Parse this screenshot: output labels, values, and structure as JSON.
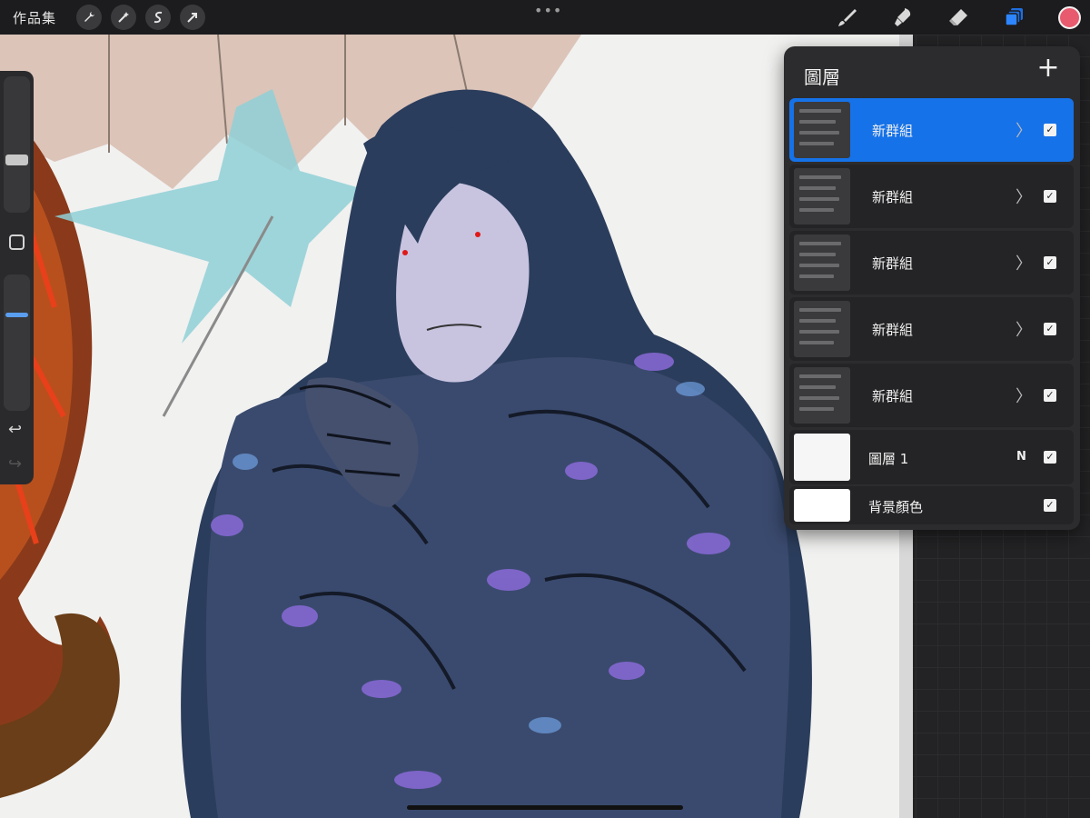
{
  "topbar": {
    "gallery_label": "作品集",
    "tools_left": [
      {
        "icon": "wrench-icon",
        "label": "actions"
      },
      {
        "icon": "magic-wand-icon",
        "label": "adjustments"
      },
      {
        "icon": "selection-icon",
        "label": "selection"
      },
      {
        "icon": "transform-arrow-icon",
        "label": "transform"
      }
    ],
    "more": "•••",
    "tools_right": [
      {
        "icon": "brush-icon"
      },
      {
        "icon": "smudge-icon"
      },
      {
        "icon": "eraser-icon"
      },
      {
        "icon": "layers-icon",
        "active": true
      }
    ],
    "current_color": "#e85a6e"
  },
  "sidebar": {
    "brush_size_level": 0.62,
    "opacity_level": 0.38,
    "undo": "↩",
    "redo": "↪"
  },
  "layers": {
    "title": "圖層",
    "add": "+",
    "items": [
      {
        "name": "新群組",
        "type": "group",
        "selected": true,
        "visible": true
      },
      {
        "name": "新群組",
        "type": "group",
        "selected": false,
        "visible": true
      },
      {
        "name": "新群組",
        "type": "group",
        "selected": false,
        "visible": true
      },
      {
        "name": "新群組",
        "type": "group",
        "selected": false,
        "visible": true
      },
      {
        "name": "新群組",
        "type": "group",
        "selected": false,
        "visible": true
      },
      {
        "name": "圖層 1",
        "type": "layer",
        "blend": "N",
        "selected": false,
        "visible": true
      },
      {
        "name": "背景顏色",
        "type": "background",
        "selected": false,
        "visible": true
      }
    ],
    "check": "✓",
    "chevron": "〉"
  },
  "colors": {
    "accent": "#1672e8",
    "panel": "#2c2c2e",
    "toolbar": "#1c1c1e",
    "active_tool": "#1e6fe0"
  }
}
